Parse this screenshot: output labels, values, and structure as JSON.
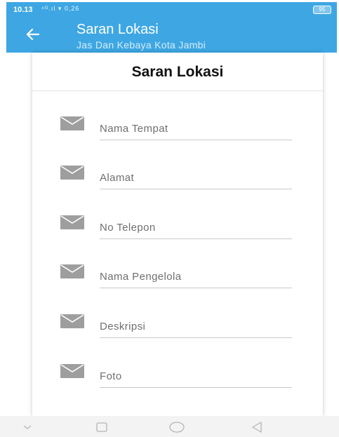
{
  "status_bar": {
    "time": "10.13",
    "indicators": "⁴ᴳ.ıl ▾ 0,26",
    "battery": "95"
  },
  "app_bar": {
    "back_icon": "arrow-left-icon",
    "title": "Saran Lokasi",
    "subtitle": "Jas Dan Kebaya Kota Jambi"
  },
  "form": {
    "title": "Saran Lokasi",
    "fields": [
      {
        "icon": "envelope-icon",
        "placeholder": "Nama Tempat"
      },
      {
        "icon": "envelope-icon",
        "placeholder": "Alamat"
      },
      {
        "icon": "envelope-icon",
        "placeholder": "No Telepon"
      },
      {
        "icon": "envelope-icon",
        "placeholder": "Nama Pengelola"
      },
      {
        "icon": "envelope-icon",
        "placeholder": "Deskripsi"
      },
      {
        "icon": "envelope-icon",
        "placeholder": "Foto"
      }
    ]
  },
  "nav_bar": {
    "buttons": [
      "chevron-down-icon",
      "square-icon",
      "circle-icon",
      "triangle-back-icon"
    ]
  },
  "colors": {
    "accent": "#3ea7e3",
    "icon_gray": "#9e9e9e"
  }
}
